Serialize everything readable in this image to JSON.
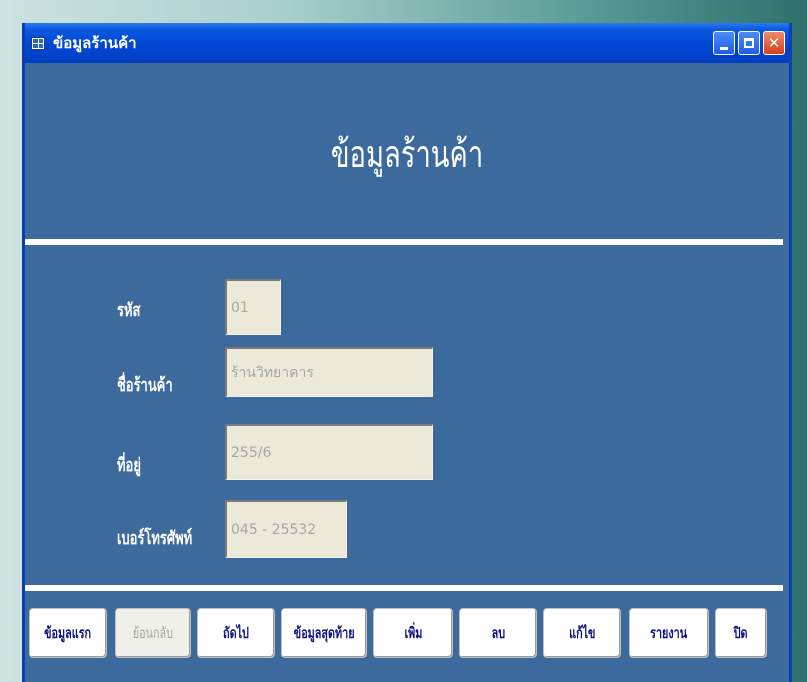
{
  "window": {
    "title": "ข้อมูลร้านค้า"
  },
  "form": {
    "heading": "ข้อมูลร้านค้า",
    "fields": [
      {
        "label": "รหัส",
        "value": "01"
      },
      {
        "label": "ชื่อร้านค้า",
        "value": "ร้านวิทยาคาร"
      },
      {
        "label": "ที่อยู่",
        "value": "255/6"
      },
      {
        "label": "เบอร์โทรศัพท์",
        "value": "045 - 25532"
      }
    ]
  },
  "buttons": [
    {
      "label": "ข้อมูลแรก",
      "enabled": true
    },
    {
      "label": "ย้อนกลับ",
      "enabled": false
    },
    {
      "label": "ถัดไป",
      "enabled": true
    },
    {
      "label": "ข้อมูลสุดท้าย",
      "enabled": true
    },
    {
      "label": "เพิ่ม",
      "enabled": true
    },
    {
      "label": "ลบ",
      "enabled": true
    },
    {
      "label": "แก้ไข",
      "enabled": true
    },
    {
      "label": "รายงาน",
      "enabled": true
    },
    {
      "label": "ปิด",
      "enabled": true
    }
  ]
}
